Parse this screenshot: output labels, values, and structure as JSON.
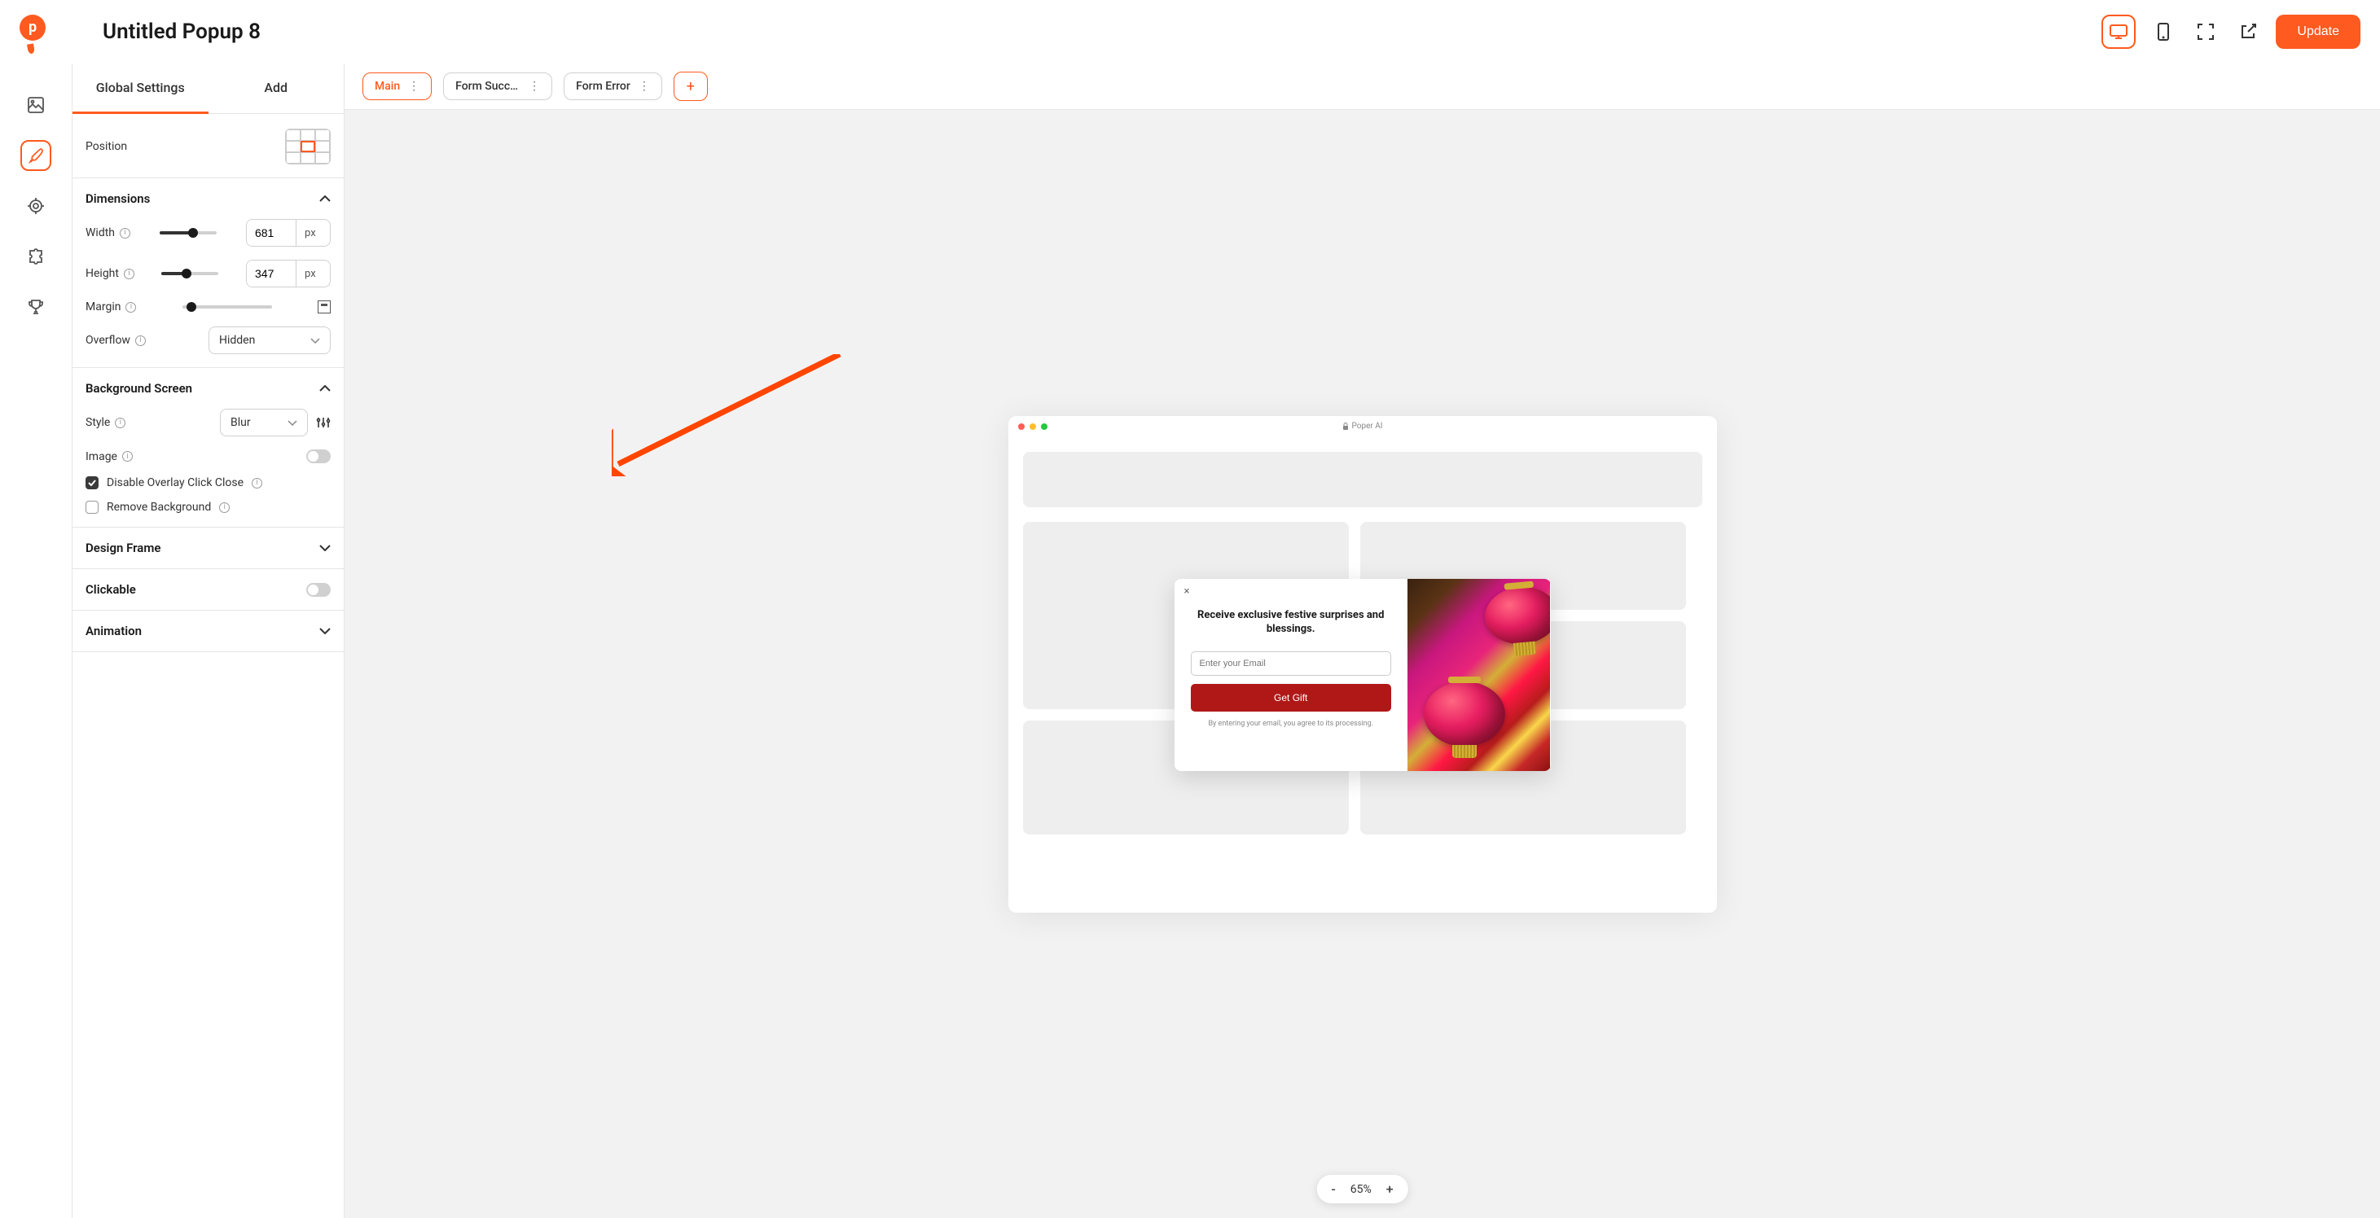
{
  "header": {
    "title": "Untitled Popup 8",
    "update_label": "Update"
  },
  "sidebar": {
    "tabs": {
      "global": "Global Settings",
      "add": "Add"
    },
    "position": {
      "label": "Position"
    },
    "dimensions": {
      "title": "Dimensions",
      "width_label": "Width",
      "width_value": "681",
      "width_unit": "px",
      "height_label": "Height",
      "height_value": "347",
      "height_unit": "px",
      "margin_label": "Margin",
      "overflow_label": "Overflow",
      "overflow_value": "Hidden"
    },
    "background": {
      "title": "Background Screen",
      "style_label": "Style",
      "style_value": "Blur",
      "image_label": "Image",
      "disable_overlay_label": "Disable Overlay Click Close",
      "remove_bg_label": "Remove Background"
    },
    "design_frame": {
      "title": "Design Frame"
    },
    "clickable": {
      "title": "Clickable"
    },
    "animation": {
      "title": "Animation"
    }
  },
  "canvas": {
    "tabs": {
      "main": "Main",
      "success": "Form Succe…",
      "error": "Form Error",
      "add": "+"
    },
    "browser_title": "Poper AI",
    "zoom": {
      "minus": "-",
      "level": "65%",
      "plus": "+"
    }
  },
  "popup": {
    "close": "×",
    "heading": "Receive exclusive festive surprises and blessings.",
    "placeholder": "Enter your Email",
    "button": "Get Gift",
    "disclaimer": "By entering your email, you agree to its processing."
  }
}
